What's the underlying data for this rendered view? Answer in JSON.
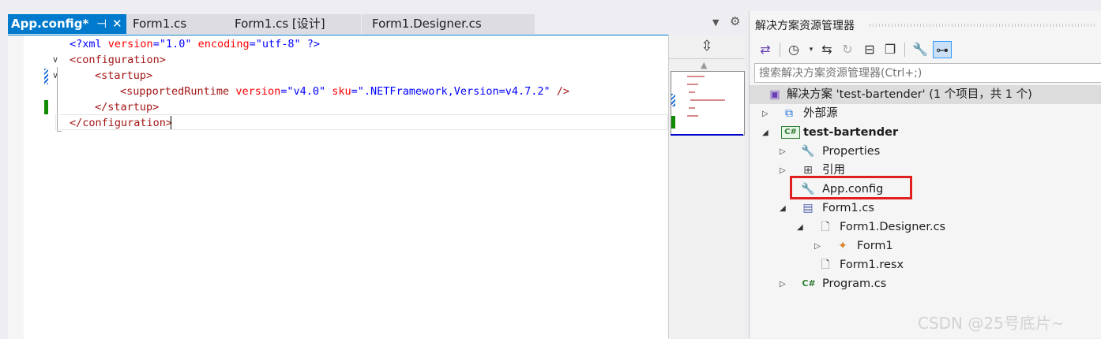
{
  "editor_tabs": [
    {
      "label": "App.config*",
      "pin_icon": "⊣",
      "close_icon": "✕",
      "active": true
    },
    {
      "label": "Form1.cs"
    },
    {
      "label": "Form1.cs [设计]"
    },
    {
      "label": "Form1.Designer.cs"
    }
  ],
  "code": {
    "line1": {
      "open": "<?xml ",
      "attr1": "version",
      "eq": "=",
      "val1": "\"1.0\"",
      "attr2": " encoding",
      "val2": "\"utf-8\"",
      "close": " ?>"
    },
    "line2": "<configuration>",
    "line3": "<startup>",
    "line4": {
      "open": "<supportedRuntime ",
      "attr1": "version",
      "val1": "\"v4.0\"",
      "attr2": " sku",
      "val2": "\".NETFramework,Version=v4.7.2\"",
      "close": " />"
    },
    "line5": "</startup>",
    "line6": "</configuration>"
  },
  "solution_explorer": {
    "title": "解决方案资源管理器",
    "search_placeholder": "搜索解决方案资源管理器(Ctrl+;)",
    "tree": {
      "solution": "解决方案 'test-bartender' (1 个项目，共 1 个)",
      "external": "外部源",
      "project": "test-bartender",
      "properties": "Properties",
      "references": "引用",
      "appconfig": "App.config",
      "form1": "Form1.cs",
      "designer": "Form1.Designer.cs",
      "form1class": "Form1",
      "resx": "Form1.resx",
      "program": "Program.cs"
    },
    "icons": {
      "csharp": "C#"
    }
  },
  "watermark": "CSDN @25号底片~",
  "colors": {
    "accent": "#007acc",
    "highlight": "#e02020",
    "tag": "#a31515",
    "attr": "#ff0000",
    "value": "#0000ff"
  }
}
